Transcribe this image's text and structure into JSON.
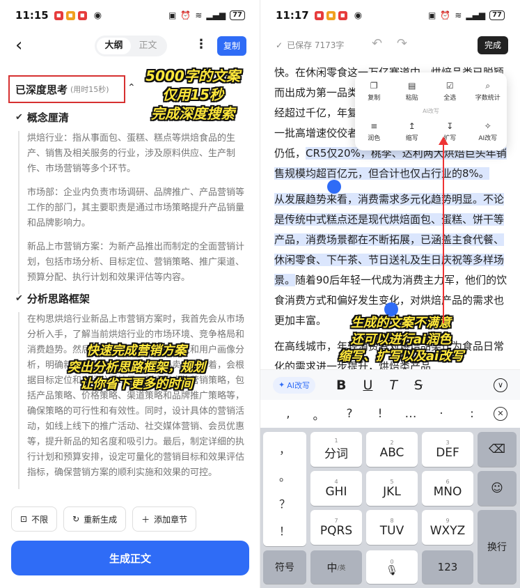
{
  "left": {
    "status": {
      "time": "11:15",
      "battery": "77"
    },
    "header": {
      "tabs": [
        "大纲",
        "正文"
      ],
      "active_tab": 0,
      "copy_label": "复制"
    },
    "deep_think": {
      "title": "已深度思考",
      "subtitle": "(用时15秒)"
    },
    "sections": [
      {
        "title": "概念厘清",
        "paragraphs": [
          "烘焙行业：指从事面包、蛋糕、糕点等烘焙食品的生产、销售及相关服务的行业，涉及原料供应、生产制作、市场营销等多个环节。",
          "市场部：企业内负责市场调研、品牌推广、产品营销等工作的部门，其主要职责是通过市场策略提升产品销量和品牌影响力。",
          "新品上市营销方案：为新产品推出而制定的全面营销计划，包括市场分析、目标定位、营销策略、推广渠道、预算分配、执行计划和效果评估等内容。"
        ]
      },
      {
        "title": "分析思路框架",
        "paragraphs": [
          "在构思烘焙行业新品上市营销方案时，我首先会从市场分析入手，了解当前烘焙行业的市场环境、竞争格局和消费趋势。然后，会对新品进行目标定位和用户画像分析，明确新品的目标消费群体和核心卖点。接着，会根据目标定位和市场分析结果，制定相应的营销策略，包括产品策略、价格策略、渠道策略和品牌推广策略等，确保策略的可行性和有效性。同时，设计具体的营销活动，如线上线下的推广活动、社交媒体营销、会员优惠等，提升新品的知名度和吸引力。最后，制定详细的执行计划和预算安排，设定可量化的营销目标和效果评估指标，确保营销方案的顺利实施和效果的可控。"
        ]
      }
    ],
    "buttons": {
      "b1": "不限",
      "b2": "重新生成",
      "b3": "添加章节",
      "generate": "生成正文"
    },
    "annotations": {
      "top": [
        "5000字的文案",
        "仅用15秒",
        "完成深度搜索"
      ],
      "mid": [
        "快速完成营销方案",
        "突出分析思路框架，规划",
        "让你省下更多的时间"
      ]
    }
  },
  "right": {
    "status": {
      "time": "11:17",
      "battery": "77"
    },
    "header": {
      "saved": "已保存 7173字",
      "done": "完成"
    },
    "menu": {
      "row1": [
        "复制",
        "粘贴",
        "全选",
        "字数统计"
      ],
      "ai_label": "AI改写",
      "row2": [
        "润色",
        "缩写",
        "扩写",
        "AI改写"
      ]
    },
    "text": {
      "p1": "快。在休闲零食这一万亿赛道中，烘焙品类已脱颖而出成为第一品类。烘焙食品的市场零售规模就已经超过千亿，年复合增长率高速增长，并且形成了一批高增速佼佼者。不过，从细分行业来看集中度仍低，",
      "p1_hl": "CR5仅20%，桃李、达利两大烘焙巨头年销售规模均超百亿元，但合计也仅占行业的8%。",
      "p2_hl": "从发展趋势来看，消费需求多元化趋势明显。不论是传统中式糕点还是现代烘焙面包、蛋糕、饼干等产品，消费场景都在不断拓展，已涵盖主食代餐、休闲零食、下午茶、节日送礼及生日庆祝等多样场景。",
      "p2": "随着90后年轻一代成为消费主力军，他们的饮食消费方式和偏好发生变化，对烘焙产品的需求也更加丰富。",
      "p3": "在高线城市，年轻消费者对烘焙品类作为食品日常化的需求进一步提升，烘焙类产品"
    },
    "toolbar": {
      "ai": "AI改写",
      "b": "B",
      "u": "U",
      "i": "T",
      "s": "S"
    },
    "punct": [
      ",",
      "。",
      "?",
      "!",
      "…",
      "·",
      ":"
    ],
    "keyboard": {
      "side": [
        "，",
        "。",
        "？",
        "！"
      ],
      "rows": [
        [
          {
            "n": "1",
            "l": "分词"
          },
          {
            "n": "2",
            "l": "ABC"
          },
          {
            "n": "3",
            "l": "DEF"
          }
        ],
        [
          {
            "n": "4",
            "l": "GHI"
          },
          {
            "n": "5",
            "l": "JKL"
          },
          {
            "n": "6",
            "l": "MNO"
          }
        ],
        [
          {
            "n": "7",
            "l": "PQRS"
          },
          {
            "n": "8",
            "l": "TUV"
          },
          {
            "n": "9",
            "l": "WXYZ"
          }
        ]
      ],
      "symbols": "符号",
      "zh": "中",
      "zh_sub": "/英",
      "space_num": "0",
      "num": "123",
      "enter": "换行"
    },
    "annotation": [
      "生成的文案不满意",
      "还可以进行ai润色",
      "缩写、扩写以及ai改写"
    ]
  }
}
